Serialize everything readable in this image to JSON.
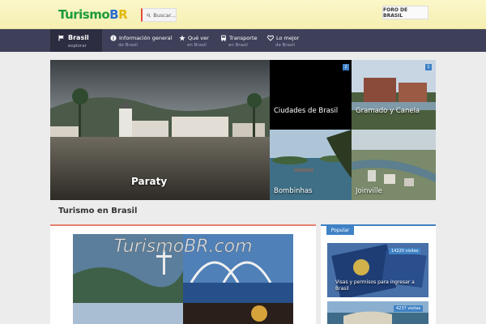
{
  "header": {
    "logo_text": "TurismoBR",
    "search_placeholder": "Buscar...",
    "forum_button": "FORO DE BRASIL"
  },
  "nav": {
    "current": {
      "label": "Brasil",
      "sub": "explorar"
    },
    "items": [
      {
        "label": "Información general",
        "sub": "de Brasil",
        "icon": "info-icon"
      },
      {
        "label": "Qué ver",
        "sub": "en Brasil",
        "icon": "star-icon"
      },
      {
        "label": "Transporte",
        "sub": "en Brasil",
        "icon": "bus-icon"
      },
      {
        "label": "Lo mejor",
        "sub": "de Brasil",
        "icon": "heart-icon"
      }
    ]
  },
  "hero": {
    "main": {
      "caption": "Paraty"
    },
    "tiles": [
      {
        "caption": "Ciudades de Brasil",
        "badge": "2"
      },
      {
        "caption": "Gramado y Canela",
        "badge": "1"
      },
      {
        "caption": "Bombinhas"
      },
      {
        "caption": "Joinville"
      }
    ]
  },
  "section": {
    "title": "Turismo en Brasil"
  },
  "main_card": {
    "watermark": "TurismoBR.com"
  },
  "sidebar": {
    "tab": "Popular",
    "posts": [
      {
        "visits": "14220 visitas",
        "title": "Visas y permisos para ingresar a Brasil"
      },
      {
        "visits": "4237 visitas"
      }
    ]
  },
  "colors": {
    "nav_bg": "#3e4059",
    "accent_blue": "#3f82c5",
    "accent_red": "#e8806e",
    "header_bg": "#f7f2b8"
  }
}
